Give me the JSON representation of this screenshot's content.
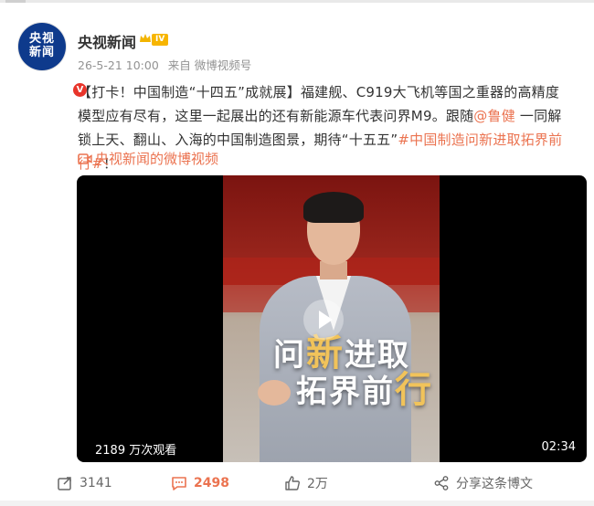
{
  "post": {
    "author": "央视新闻",
    "avatar_text_top": "央视",
    "avatar_text_bottom": "新闻",
    "verified_badge": "V",
    "level_badge": "IV",
    "time": "26-5-21 10:00",
    "source": "来自 微博视频号",
    "text_prefix": "【打卡！中国制造“十四五”成就展】福建舰、C919大飞机等国之重器的高精度模型应有尽有，这里一起展出的还有新能源车代表问界M9。跟随",
    "mention": "@鲁健",
    "text_middle": " 一同解锁上天、翻山、入海的中国制造图景，期待“十五五”",
    "hashtag": "#中国制造问新进取拓界前行#",
    "text_suffix": "！",
    "video_source_link": "央视新闻的微博视频"
  },
  "video": {
    "overlay_line1_a": "问",
    "overlay_line1_b": "新",
    "overlay_line1_c": "进取",
    "overlay_line2_a": "拓界前",
    "overlay_line2_b": "行",
    "views": "2189 万次观看",
    "duration": "02:34"
  },
  "actions": {
    "share_count": "3141",
    "comment_count": "2498",
    "like_count": "2万",
    "share_this_label": "分享这条博文"
  },
  "colors": {
    "accent": "#eb7350",
    "text": "#333333",
    "meta": "#939393"
  }
}
